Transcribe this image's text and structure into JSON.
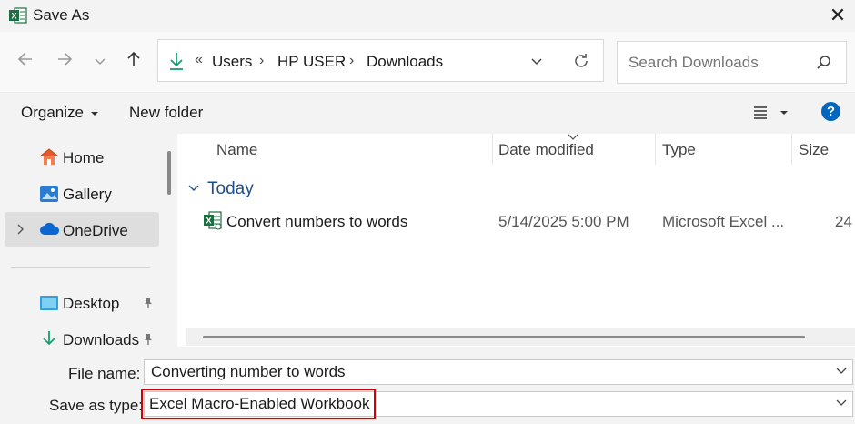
{
  "window": {
    "title": "Save As",
    "close_glyph": "✕"
  },
  "nav": {
    "back_icon": "arrow-left-icon",
    "forward_icon": "arrow-right-icon",
    "recent_icon": "chevron-down-icon",
    "up_icon": "arrow-up-icon",
    "address": {
      "overflow": "«",
      "crumbs": [
        "Users",
        "HP USER",
        "Downloads"
      ]
    },
    "search_placeholder": "Search Downloads"
  },
  "toolbar": {
    "organize": "Organize",
    "new_folder": "New folder"
  },
  "sidebar": {
    "items": [
      {
        "label": "Home",
        "icon": "home-icon"
      },
      {
        "label": "Gallery",
        "icon": "gallery-icon"
      },
      {
        "label": "OneDrive",
        "icon": "onedrive-icon",
        "selected": true
      },
      {
        "label": "Desktop",
        "icon": "desktop-icon",
        "pinned": true
      },
      {
        "label": "Downloads",
        "icon": "downloads-icon",
        "pinned": true
      }
    ]
  },
  "columns": [
    "Name",
    "Date modified",
    "Type",
    "Size"
  ],
  "groups": [
    {
      "label": "Today",
      "files": [
        {
          "name": "Convert numbers to words",
          "date": "5/14/2025 5:00 PM",
          "type": "Microsoft Excel ...",
          "size": "24"
        }
      ]
    }
  ],
  "form": {
    "file_name_label": "File name:",
    "file_name_value": "Converting number to words",
    "type_label": "Save as type:",
    "type_value": "Excel Macro-Enabled Workbook"
  },
  "colors": {
    "excel_green": "#1d6f42",
    "accent_blue": "#0067c0",
    "highlight_red": "#d40000"
  }
}
